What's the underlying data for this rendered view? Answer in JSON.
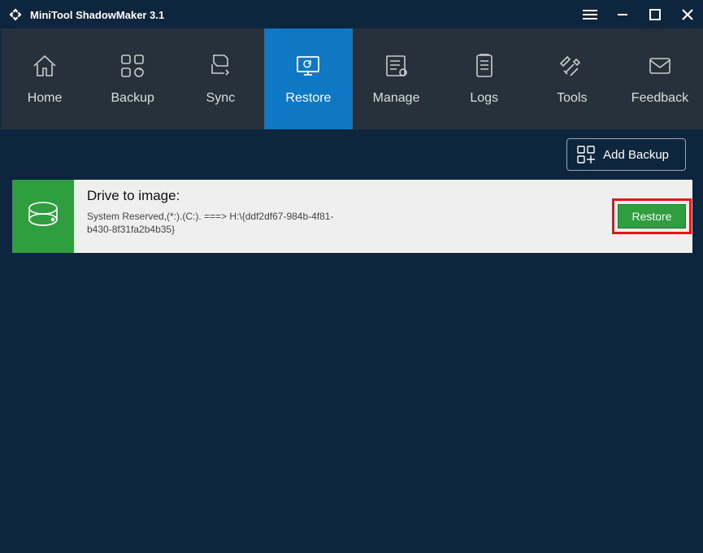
{
  "window": {
    "title": "MiniTool ShadowMaker 3.1"
  },
  "nav": {
    "home": "Home",
    "backup": "Backup",
    "sync": "Sync",
    "restore": "Restore",
    "manage": "Manage",
    "logs": "Logs",
    "tools": "Tools",
    "feedback": "Feedback"
  },
  "toolbar": {
    "add_backup": "Add Backup"
  },
  "card": {
    "title": "Drive to image:",
    "detail": "System Reserved,(*:).(C:). ===> H:\\{ddf2df67-984b-4f81-b430-8f31fa2b4b35}",
    "restore": "Restore"
  }
}
